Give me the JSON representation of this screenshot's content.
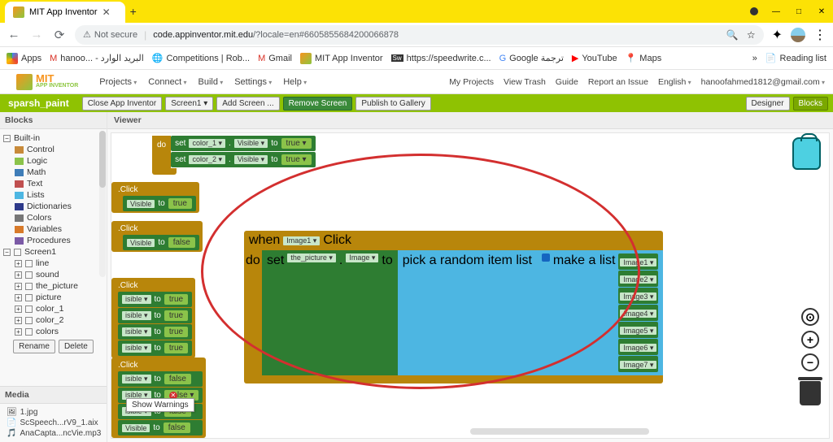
{
  "browser": {
    "tab_title": "MIT App Inventor",
    "security": "Not secure",
    "url_domain": "code.appinventor.mit.edu",
    "url_path": "/?locale=en#6605855684200066878",
    "bookmarks": [
      "Apps",
      "hanoo... - البريد الوارد",
      "Competitions | Rob...",
      "Gmail",
      "MIT App Inventor",
      "https://speedwrite.c...",
      "Google ترجمة",
      "YouTube",
      "Maps"
    ],
    "reading_list": "Reading list"
  },
  "app": {
    "logo_top": "MIT",
    "logo_sub": "APP INVENTOR",
    "menus": [
      "Projects",
      "Connect",
      "Build",
      "Settings",
      "Help"
    ],
    "right": [
      "My Projects",
      "View Trash",
      "Guide",
      "Report an Issue",
      "English"
    ],
    "email": "hanoofahmed1812@gmail.com"
  },
  "bar": {
    "project": "sparsh_paint",
    "close": "Close App Inventor",
    "screen": "Screen1",
    "add": "Add Screen ...",
    "remove": "Remove Screen",
    "publish": "Publish to Gallery",
    "designer": "Designer",
    "blocks": "Blocks"
  },
  "sidebar": {
    "blocks_title": "Blocks",
    "builtin": "Built-in",
    "categories": [
      {
        "name": "Control",
        "color": "#c88a3a"
      },
      {
        "name": "Logic",
        "color": "#8bc34a"
      },
      {
        "name": "Math",
        "color": "#3f7db8"
      },
      {
        "name": "Text",
        "color": "#c05050"
      },
      {
        "name": "Lists",
        "color": "#4db6e2"
      },
      {
        "name": "Dictionaries",
        "color": "#2e3a8a"
      },
      {
        "name": "Colors",
        "color": "#777"
      },
      {
        "name": "Variables",
        "color": "#d87a2a"
      },
      {
        "name": "Procedures",
        "color": "#7b5aa6"
      }
    ],
    "screen": "Screen1",
    "components": [
      "line",
      "sound",
      "the_picture",
      "picture",
      "color_1",
      "color_2",
      "colors"
    ],
    "rename": "Rename",
    "delete": "Delete",
    "media_title": "Media",
    "media": [
      "1.jpg",
      "ScSpeech...rV9_1.aix",
      "AnaCapta...ncVie.mp3"
    ]
  },
  "viewer": {
    "title": "Viewer",
    "warn": "Show Warnings"
  },
  "blocks": {
    "do": "do",
    "set": "set",
    "to": "to",
    "when": "when",
    "click": ".Click",
    "click2": "Click",
    "visible": "Visible",
    "true": "true",
    "false": "false",
    "color1": "color_1",
    "color2": "color_2",
    "image": "Image",
    "image1": "Image1",
    "the_picture": "the_picture",
    "pick": "pick a random item  list",
    "make": "make a list",
    "imgs": [
      "Image1",
      "Image2",
      "Image3",
      "Image4",
      "Image5",
      "Image6",
      "Image7"
    ]
  }
}
